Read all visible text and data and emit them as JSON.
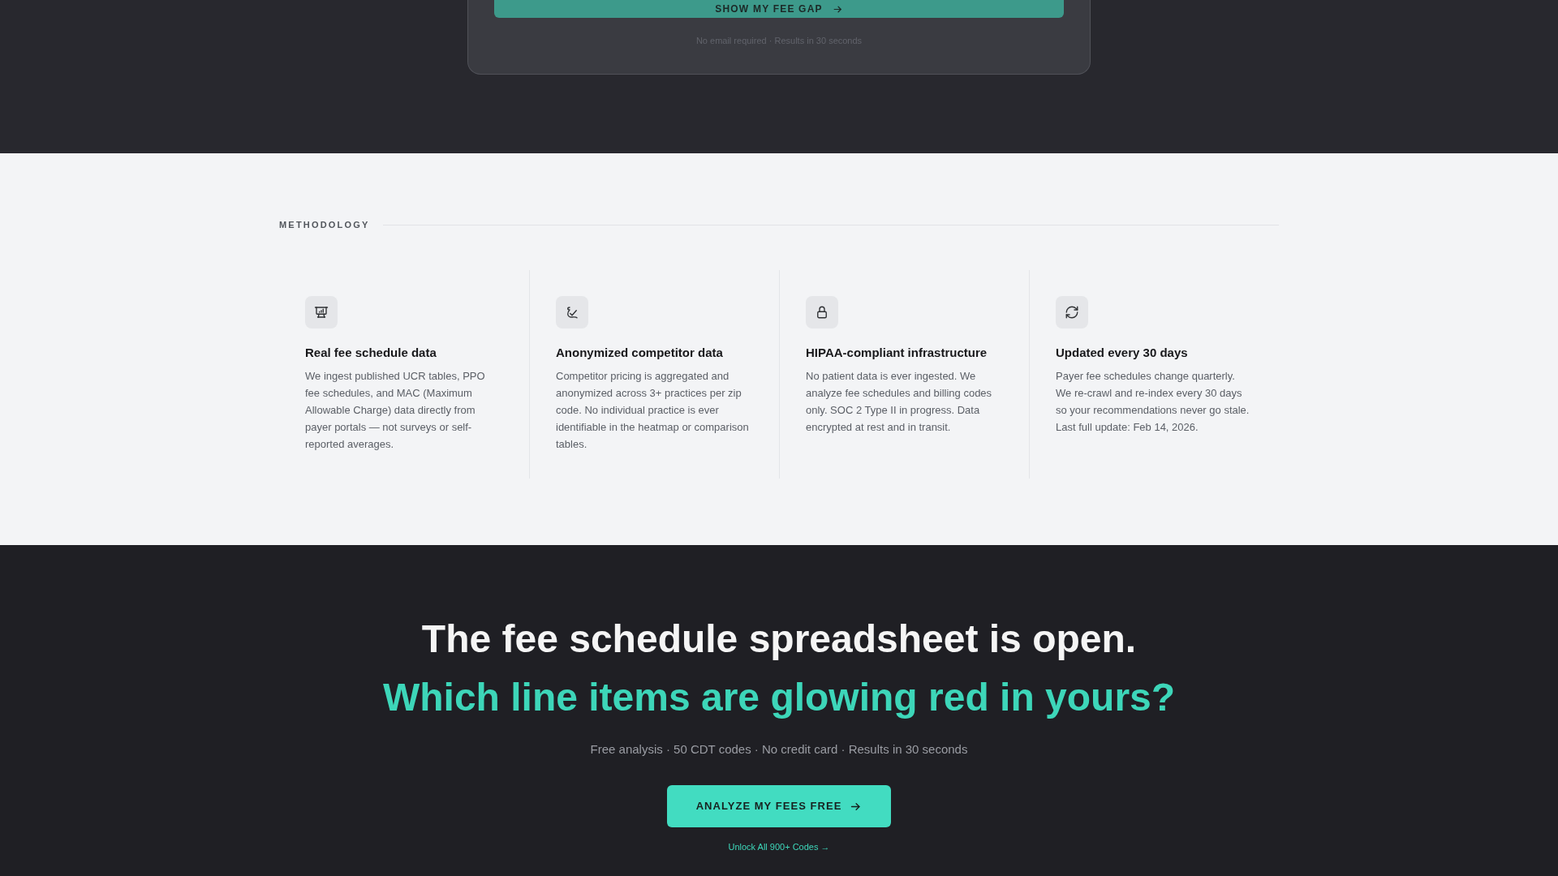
{
  "hero_card": {
    "button": {
      "label": "SHOW MY FEE GAP"
    },
    "note": "No email required · Results in 30 seconds"
  },
  "methodology": {
    "label": "METHODOLOGY",
    "features": [
      {
        "kind": "source",
        "title": "Real fee schedule data",
        "description": "We ingest published UCR tables, PPO fee schedules, and MAC (Maximum Allowable Charge) data directly from payer portals — not surveys or self-reported averages."
      },
      {
        "kind": "anonymity",
        "title": "Anonymized competitor data",
        "description": "Competitor pricing is aggregated and anonymized across 3+ practices per zip code. No individual practice is ever identifiable in the heatmap or comparison tables."
      },
      {
        "kind": "security",
        "title": "HIPAA-compliant infrastructure",
        "description": "No patient data is ever ingested. We analyze fee schedules and billing codes only. SOC 2 Type II in progress. Data encrypted at rest and in transit."
      },
      {
        "kind": "freshness",
        "title": "Updated every 30 days",
        "description": "Payer fee schedules change quarterly. We re-crawl and re-index every 30 days so your recommendations never go stale. Last full update: Feb 14, 2026."
      }
    ]
  },
  "cta": {
    "headline": "The fee schedule spreadsheet is open.",
    "headline_accent": "Which line items are glowing red in yours?",
    "tagline": "Free analysis · 50 CDT codes · No credit card · Results in 30 seconds",
    "button": {
      "label": "ANALYZE MY FEES FREE"
    },
    "link": "Unlock All 900+ Codes →"
  }
}
